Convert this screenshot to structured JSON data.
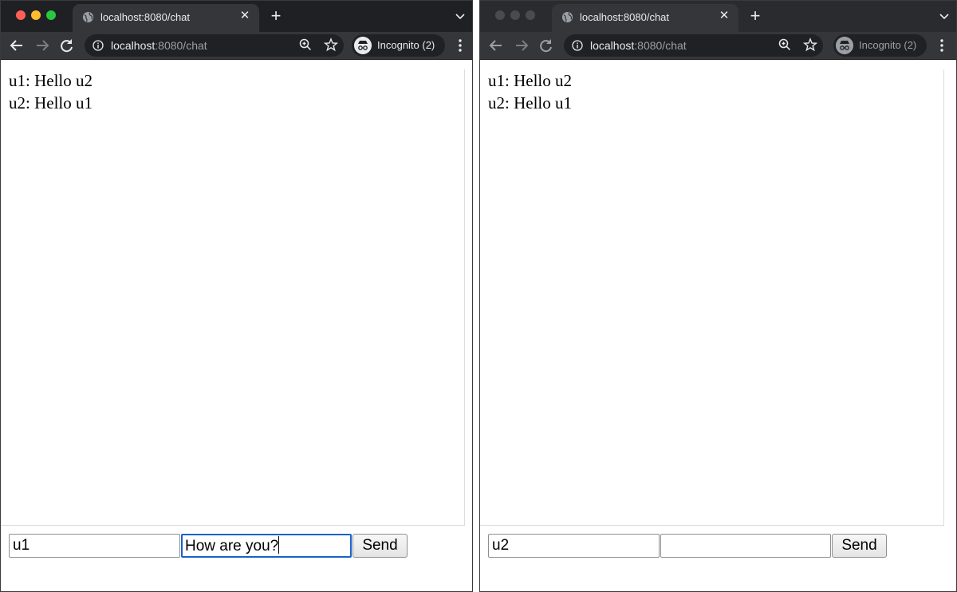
{
  "left": {
    "tab_title": "localhost:8080/chat",
    "url_host": "localhost",
    "url_rest": ":8080/chat",
    "incognito_label": "Incognito (2)",
    "messages": [
      "u1: Hello u2",
      "u2: Hello u1"
    ],
    "username_value": "u1",
    "message_value": "How are you?",
    "send_label": "Send"
  },
  "right": {
    "tab_title": "localhost:8080/chat",
    "url_host": "localhost",
    "url_rest": ":8080/chat",
    "incognito_label": "Incognito (2)",
    "messages": [
      "u1: Hello u2",
      "u2: Hello u1"
    ],
    "username_value": "u2",
    "message_value": "",
    "send_label": "Send"
  },
  "colors": {
    "close_light": "#ff5f57",
    "minimize_light": "#febc2e",
    "zoom_light": "#28c840",
    "inactive_light": "#4a4b4f",
    "focus_ring": "#1a62c9"
  },
  "icons": [
    "globe-icon",
    "close-icon",
    "plus-icon",
    "chevron-down-icon",
    "back-arrow-icon",
    "forward-arrow-icon",
    "reload-icon",
    "info-icon",
    "zoom-icon",
    "star-icon",
    "incognito-icon",
    "more-vert-icon"
  ]
}
